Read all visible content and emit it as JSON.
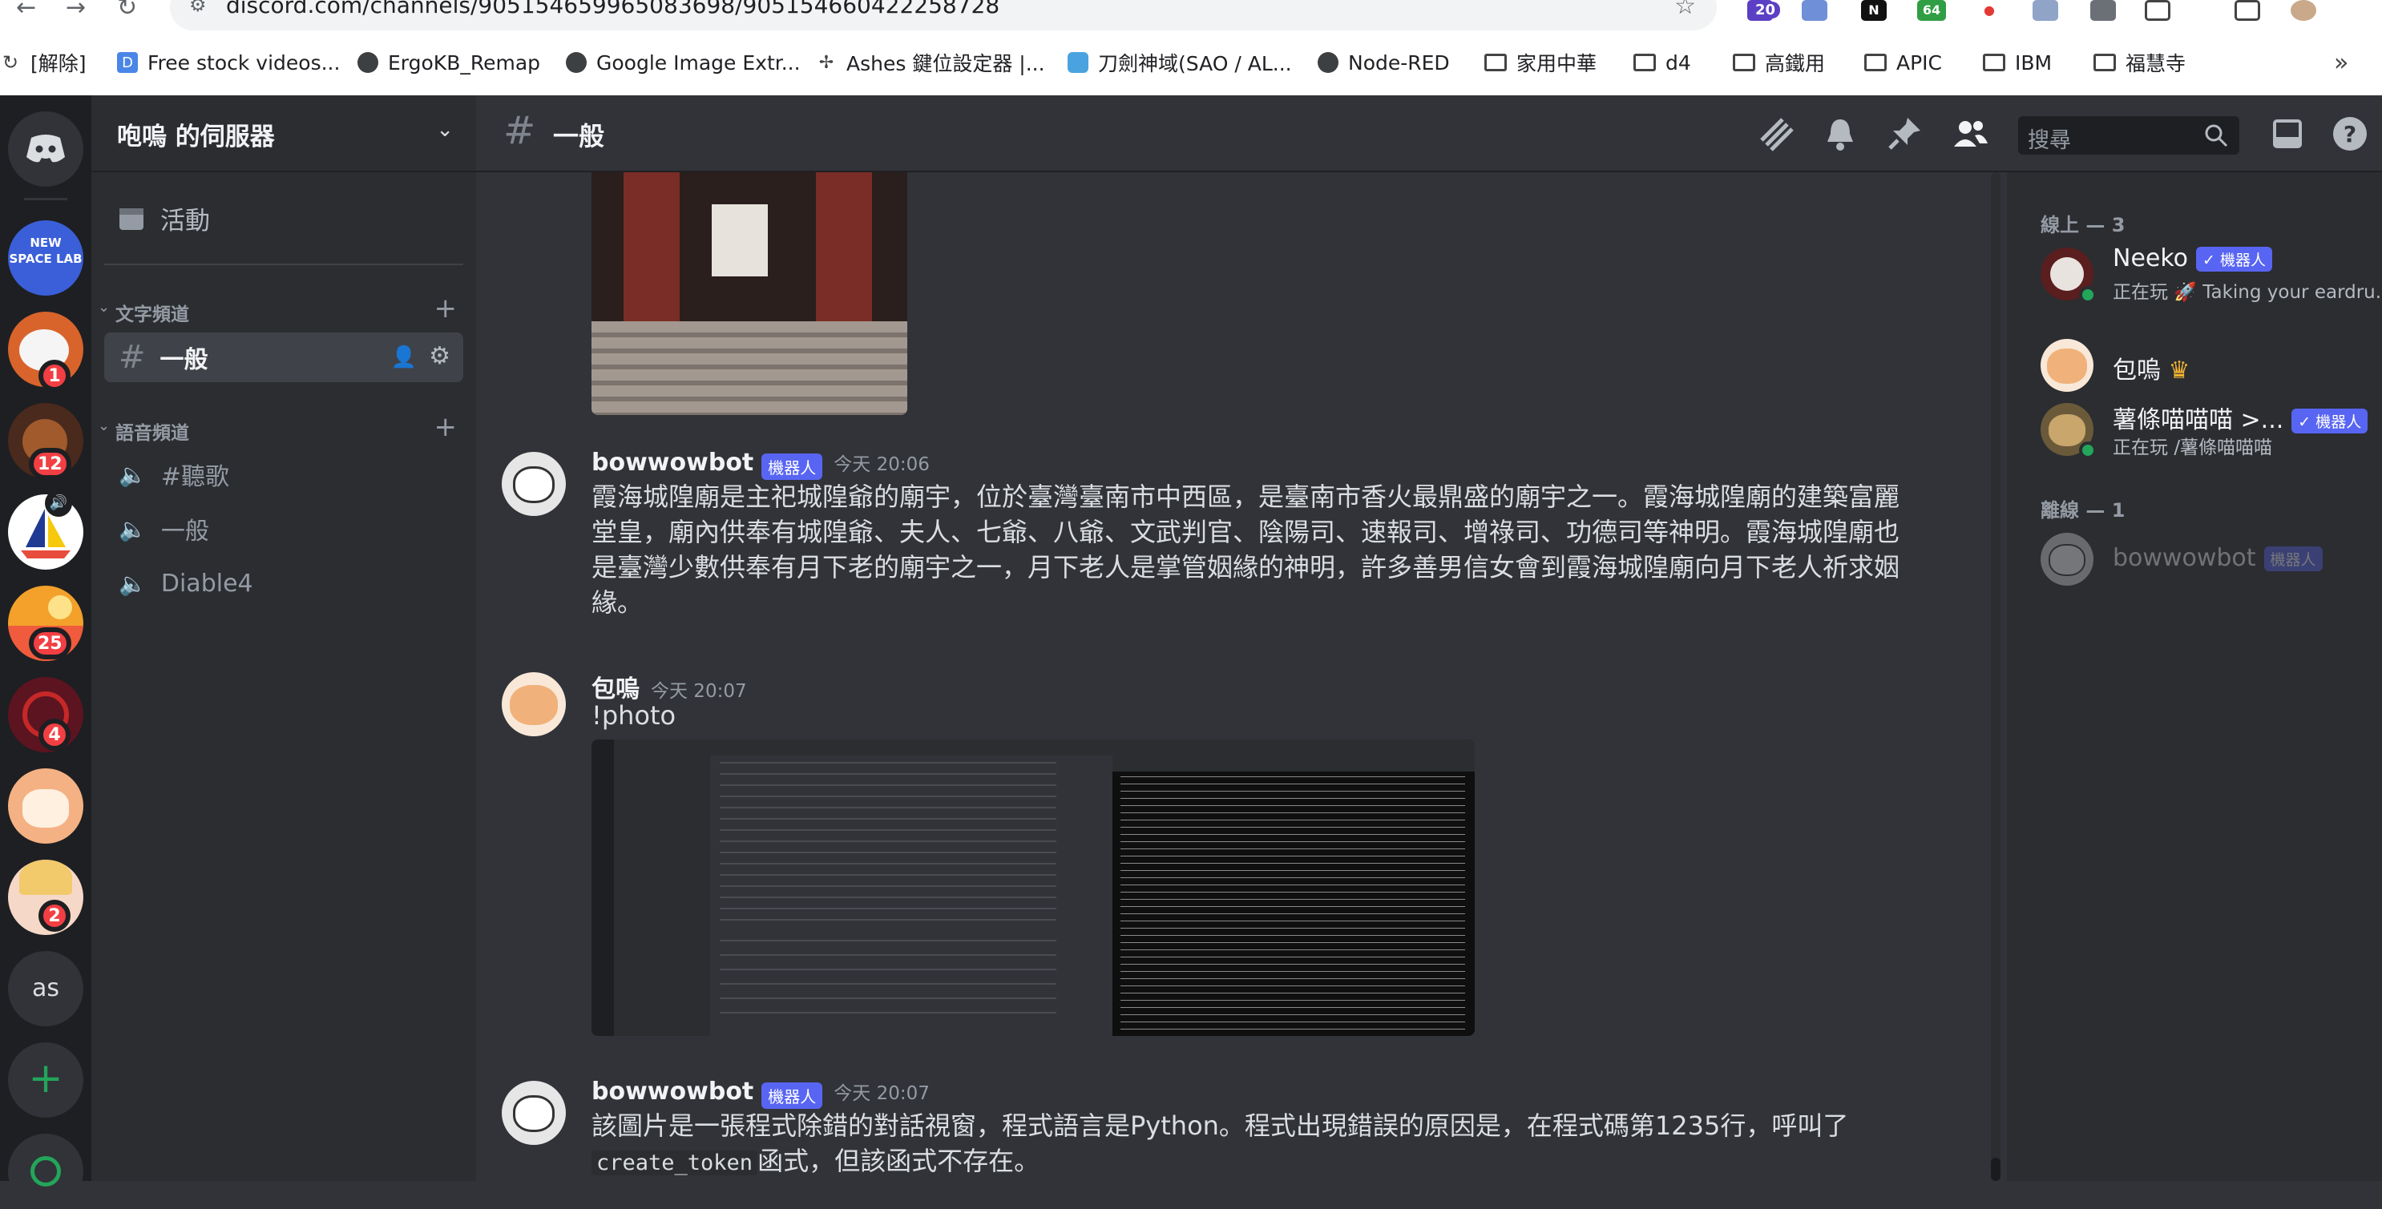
{
  "browser": {
    "url": "discord.com/channels/905154659965083698/905154660422258728",
    "extensions": [
      "20",
      "64"
    ],
    "bookmarks": [
      {
        "label": "[解除]",
        "icon": "reload-icon"
      },
      {
        "label": "Free stock videos...",
        "icon": "d-icon"
      },
      {
        "label": "ErgoKB_Remap",
        "icon": "globe-icon"
      },
      {
        "label": "Google Image Extr...",
        "icon": "globe-icon"
      },
      {
        "label": "Ashes 鍵位設定器 |...",
        "icon": "ashes-icon"
      },
      {
        "label": "刀劍神域(SAO / AL...",
        "icon": "app-icon"
      },
      {
        "label": "Node-RED",
        "icon": "globe-icon"
      },
      {
        "label": "家用中華",
        "icon": "folder-icon"
      },
      {
        "label": "d4",
        "icon": "folder-icon"
      },
      {
        "label": "高鐵用",
        "icon": "folder-icon"
      },
      {
        "label": "APIC",
        "icon": "folder-icon"
      },
      {
        "label": "IBM",
        "icon": "folder-icon"
      },
      {
        "label": "福慧寺",
        "icon": "folder-icon"
      }
    ],
    "more_bookmarks": "»"
  },
  "guilds": {
    "items": [
      {
        "name": "home",
        "badge": ""
      },
      {
        "name": "new-space-lab",
        "label": "NEW SPACE LAB",
        "badge": ""
      },
      {
        "name": "guild-3",
        "badge": "1"
      },
      {
        "name": "guild-4",
        "badge": "12"
      },
      {
        "name": "guild-5",
        "badge": ""
      },
      {
        "name": "guild-6",
        "badge": "25"
      },
      {
        "name": "guild-7",
        "badge": "4"
      },
      {
        "name": "guild-8",
        "badge": ""
      },
      {
        "name": "guild-9",
        "badge": "2"
      },
      {
        "name": "guild-as",
        "label": "as",
        "badge": ""
      }
    ],
    "add_label": "+"
  },
  "sidebar": {
    "server_name": "咆嗚 的伺服器",
    "events_label": "活動",
    "text_category": "文字頻道",
    "voice_category": "語音頻道",
    "text_channels": [
      {
        "name": "一般"
      }
    ],
    "voice_channels": [
      {
        "name": "#聽歌"
      },
      {
        "name": "一般"
      },
      {
        "name": "Diable4"
      }
    ]
  },
  "header": {
    "channel_name": "一般",
    "search_placeholder": "搜尋"
  },
  "messages": [
    {
      "author": "bowwowbot",
      "bot_badge": "機器人",
      "timestamp": "今天 20:06",
      "lines": [
        "霞海城隍廟是主祀城隍爺的廟宇，位於臺灣臺南市中西區，是臺南市香火最鼎盛的廟宇之一。霞海城隍廟的建築富麗",
        "堂皇，廟內供奉有城隍爺、夫人、七爺、八爺、文武判官、陰陽司、速報司、增祿司、功德司等神明。霞海城隍廟也",
        "是臺灣少數供奉有月下老的廟宇之一，月下老人是掌管姻緣的神明，許多善男信女會到霞海城隍廟向月下老人祈求姻",
        "緣。"
      ]
    },
    {
      "author": "包嗚",
      "timestamp": "今天 20:07",
      "text": "!photo"
    },
    {
      "author": "bowwowbot",
      "bot_badge": "機器人",
      "timestamp": "今天 20:07",
      "line1": "該圖片是一張程式除錯的對話視窗，程式語言是Python。程式出現錯誤的原因是，在程式碼第1235行，呼叫了",
      "code": "create_token",
      "line2_suffix": "函式，但該函式不存在。"
    }
  ],
  "members": {
    "online_label": "線上 — 3",
    "offline_label": "離線 — 1",
    "online": [
      {
        "name": "Neeko",
        "badge": "✓ 機器人",
        "activity_prefix": "正在玩",
        "activity": "🚀 Taking your eardru..."
      },
      {
        "name": "包嗚",
        "crown": "♛"
      },
      {
        "name": "薯條喵喵喵 >...",
        "badge": "✓ 機器人",
        "activity_prefix": "正在玩",
        "activity": "/薯條喵喵喵"
      }
    ],
    "offline": [
      {
        "name": "bowwowbot",
        "badge": "機器人"
      }
    ]
  },
  "colors": {
    "accent": "#5865f2",
    "online": "#23a55a",
    "badge_red": "#f23f43"
  }
}
